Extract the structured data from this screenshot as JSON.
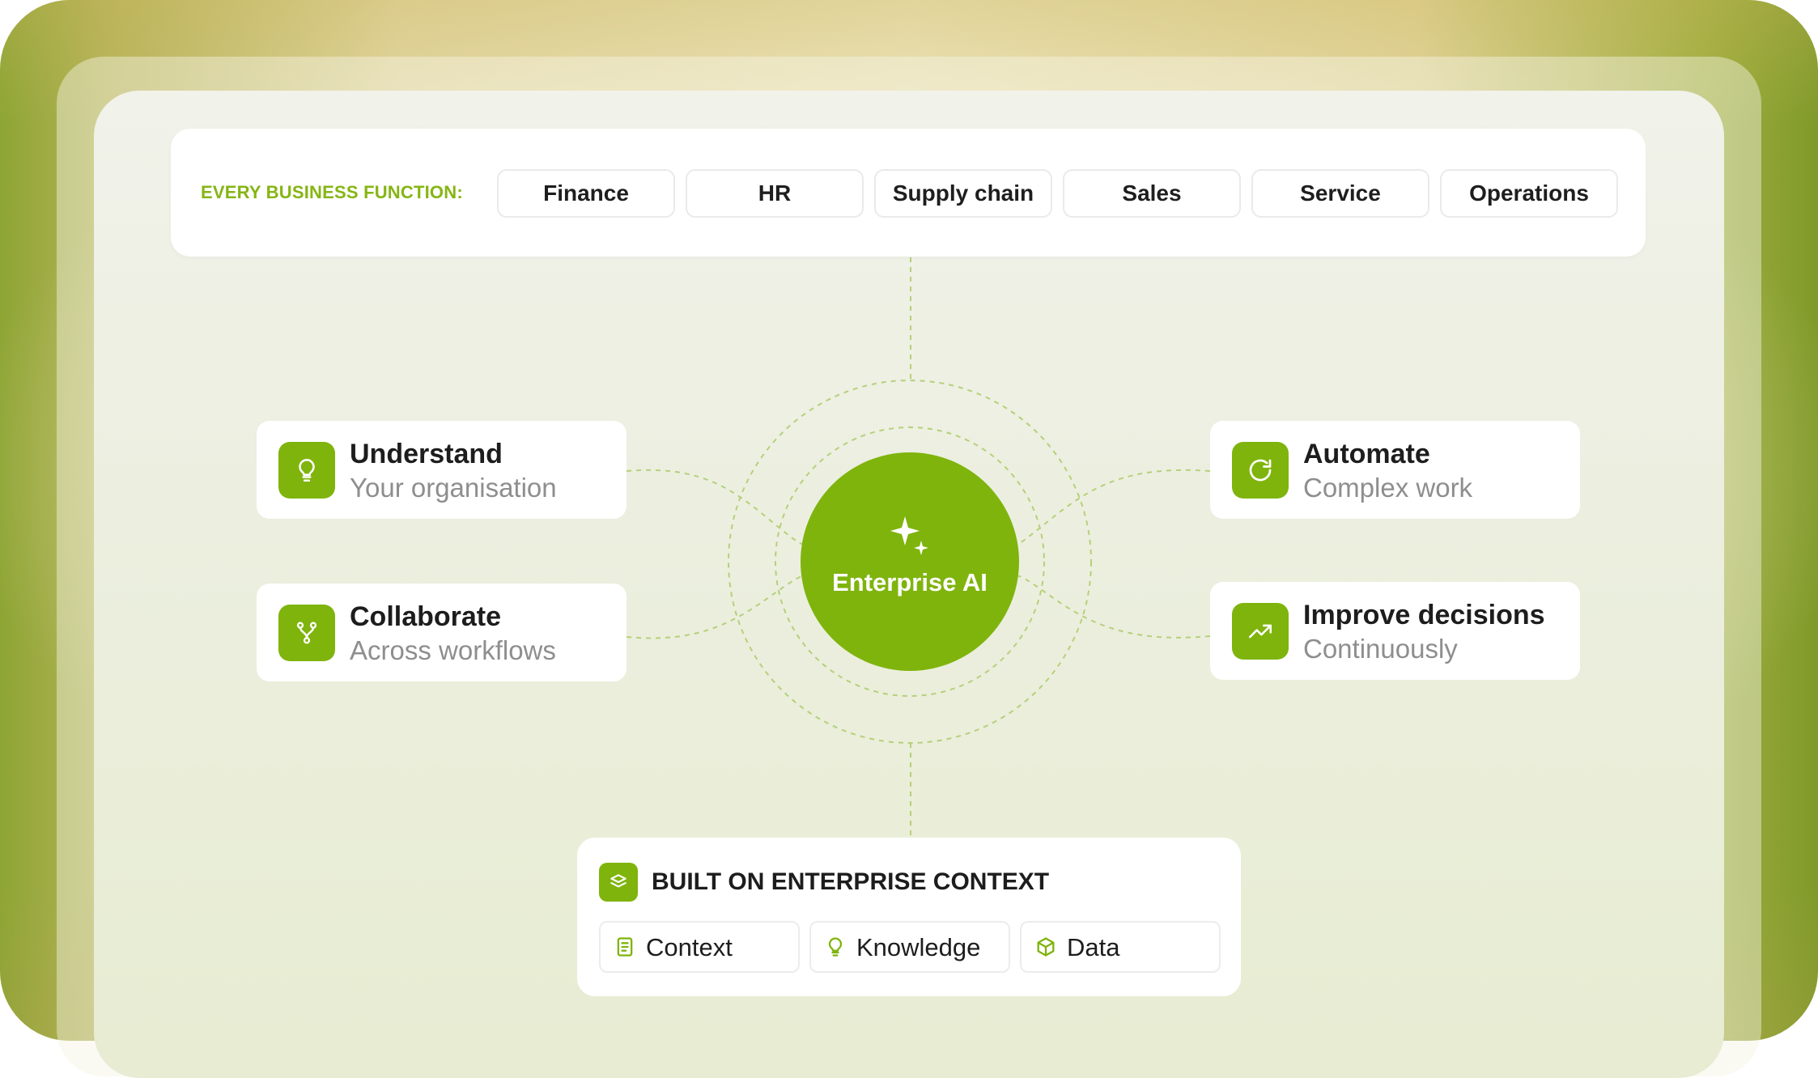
{
  "top_bar": {
    "label": "EVERY BUSINESS FUNCTION:",
    "functions": [
      "Finance",
      "HR",
      "Supply chain",
      "Sales",
      "Service",
      "Operations"
    ]
  },
  "hub": {
    "label": "Enterprise AI",
    "icon": "sparkles-icon"
  },
  "capabilities": [
    {
      "title": "Understand",
      "subtitle": "Your organisation",
      "icon": "lightbulb-icon"
    },
    {
      "title": "Collaborate",
      "subtitle": "Across workflows",
      "icon": "branch-icon"
    },
    {
      "title": "Automate",
      "subtitle": "Complex work",
      "icon": "refresh-icon"
    },
    {
      "title": "Improve decisions",
      "subtitle": "Continuously",
      "icon": "trend-up-icon"
    }
  ],
  "foundation": {
    "title": "BUILT ON ENTERPRISE CONTEXT",
    "icon": "layers-icon",
    "items": [
      {
        "label": "Context",
        "icon": "document-icon"
      },
      {
        "label": "Knowledge",
        "icon": "lightbulb-icon"
      },
      {
        "label": "Data",
        "icon": "cube-icon"
      }
    ]
  },
  "colors": {
    "accent": "#7fb40d",
    "label_green": "#86b514",
    "subtitle": "#8e8e8e"
  }
}
